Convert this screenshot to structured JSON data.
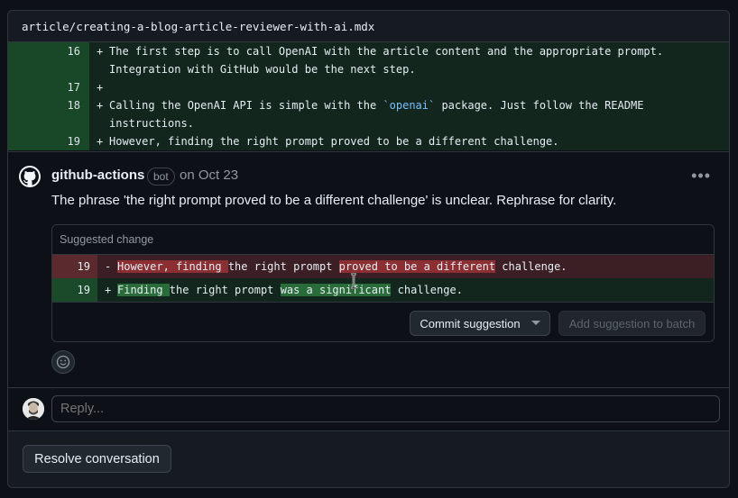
{
  "file": {
    "path": "article/creating-a-blog-article-reviewer-with-ai.mdx"
  },
  "diff_lines": [
    {
      "num": "16",
      "sign": "+",
      "code": "The first step is to call OpenAI with the article content and the appropriate prompt.\nIntegration with GitHub would be the next step."
    },
    {
      "num": "17",
      "sign": "+",
      "code": ""
    },
    {
      "num": "18",
      "sign": "+",
      "code_before": "Calling the OpenAI API is simple with the ",
      "code_hl": "`openai`",
      "code_after": " package. Just follow the README\ninstructions."
    },
    {
      "num": "19",
      "sign": "+",
      "code": "However, finding the right prompt proved to be a different challenge."
    }
  ],
  "comment": {
    "author": "github-actions",
    "badge": "bot",
    "date": "on Oct 23",
    "more_label": "•••",
    "body": "The phrase 'the right prompt proved to be a different challenge' is unclear. Rephrase for clarity."
  },
  "suggestion": {
    "header": "Suggested change",
    "deleted": {
      "num": "19",
      "sign": "-",
      "hl1": "However, finding ",
      "mid": "the right prompt ",
      "hl2": "proved to be a different",
      "end": " challenge."
    },
    "added": {
      "num": "19",
      "sign": "+",
      "hl1": "Finding ",
      "mid": "the right prompt ",
      "hl2": "was a significant",
      "end": " challenge."
    },
    "commit_label": "Commit suggestion",
    "batch_label": "Add suggestion to batch"
  },
  "reply": {
    "placeholder": "Reply..."
  },
  "resolve": {
    "label": "Resolve conversation"
  },
  "colors": {
    "addition_bg": "#12261e",
    "deletion_bg": "#3c1f24",
    "accent_blue": "#79c0ff"
  },
  "icons": [
    "github-mark-icon",
    "kebab-menu-icon",
    "smiley-icon",
    "caret-down-icon",
    "text-cursor-icon"
  ]
}
